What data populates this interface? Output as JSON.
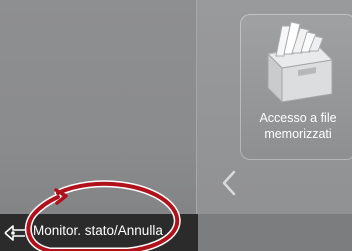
{
  "tiles": [
    {
      "label_line1": "Accesso a file",
      "label_line2": "memorizzati",
      "icon": "stored-files-icon"
    }
  ],
  "navigation": {
    "back_icon": "chevron-left-icon"
  },
  "status_bar": {
    "label": "Monitor. stato/Annulla",
    "icon": "status-monitor-icon"
  },
  "annotation": {
    "shape": "hand-drawn circle highlighting the status button",
    "color": "#b0121c"
  }
}
